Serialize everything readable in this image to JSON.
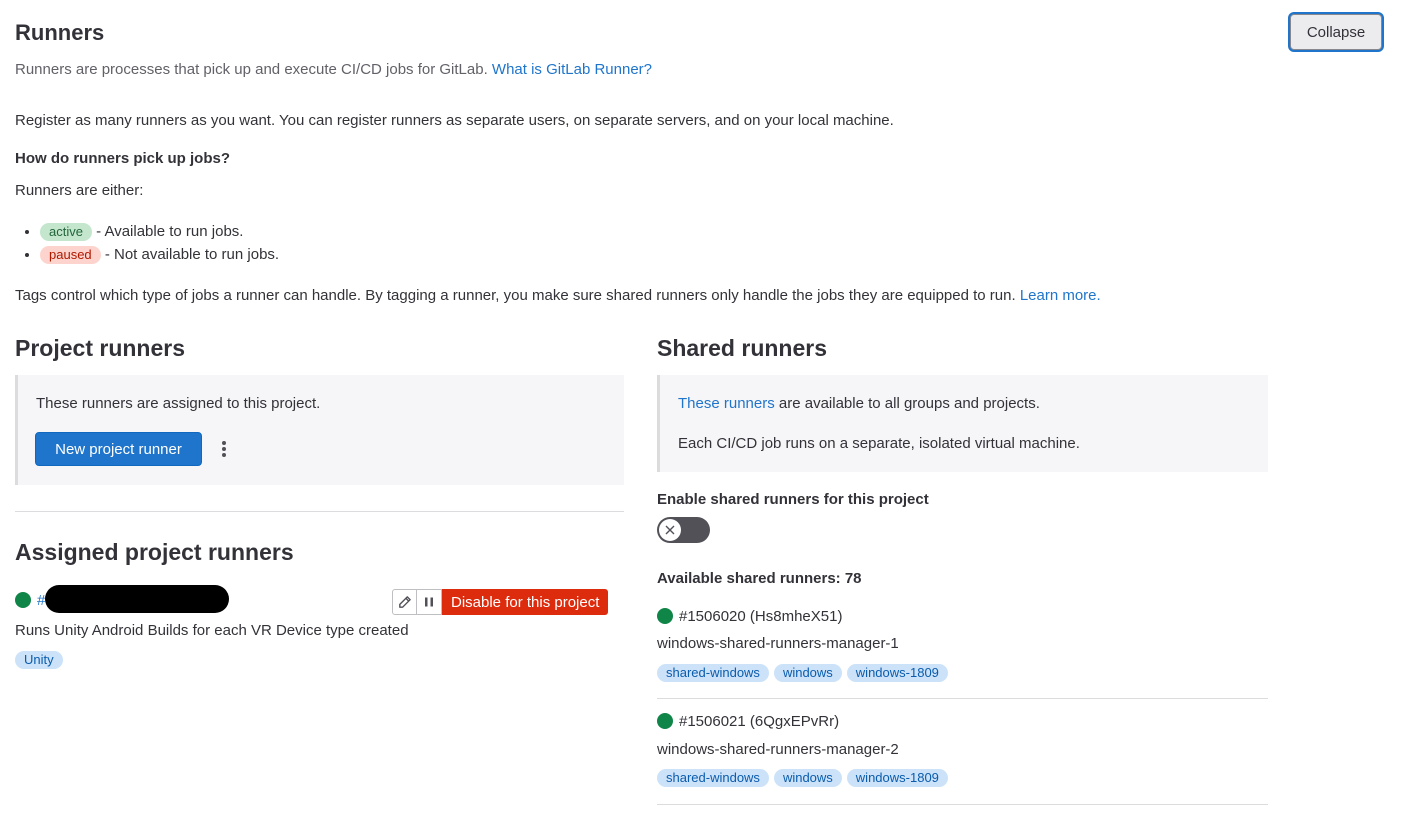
{
  "header": {
    "title": "Runners",
    "subtitle": "Runners are processes that pick up and execute CI/CD jobs for GitLab.",
    "subtitle_link": "What is GitLab Runner?",
    "collapse_label": "Collapse"
  },
  "intro": {
    "register_text": "Register as many runners as you want. You can register runners as separate users, on separate servers, and on your local machine.",
    "question": "How do runners pick up jobs?",
    "either_text": "Runners are either:",
    "states": [
      {
        "badge": "active",
        "desc": "- Available to run jobs."
      },
      {
        "badge": "paused",
        "desc": "- Not available to run jobs."
      }
    ],
    "tags_text": "Tags control which type of jobs a runner can handle. By tagging a runner, you make sure shared runners only handle the jobs they are equipped to run.",
    "tags_link": "Learn more."
  },
  "project_runners": {
    "title": "Project runners",
    "panel_text": "These runners are assigned to this project.",
    "new_button": "New project runner"
  },
  "assigned": {
    "title": "Assigned project runners",
    "runner": {
      "id_prefix": "#",
      "description": "Runs Unity Android Builds for each VR Device type created",
      "tag": "Unity",
      "disable_label": "Disable for this project"
    }
  },
  "shared_runners": {
    "title": "Shared runners",
    "panel_link": "These runners",
    "panel_text": "are available to all groups and projects.",
    "panel_text2": "Each CI/CD job runs on a separate, isolated virtual machine.",
    "enable_label": "Enable shared runners for this project",
    "toggle_state": "off",
    "available_label": "Available shared runners: 78",
    "runners": [
      {
        "id": "#1506020 (Hs8mheX51)",
        "name": "windows-shared-runners-manager-1",
        "tags": [
          "shared-windows",
          "windows",
          "windows-1809"
        ]
      },
      {
        "id": "#1506021 (6QgxEPvRr)",
        "name": "windows-shared-runners-manager-2",
        "tags": [
          "shared-windows",
          "windows",
          "windows-1809"
        ]
      }
    ]
  },
  "colors": {
    "online": "#108548",
    "primary": "#1f75cb",
    "danger": "#dd2b0e"
  }
}
